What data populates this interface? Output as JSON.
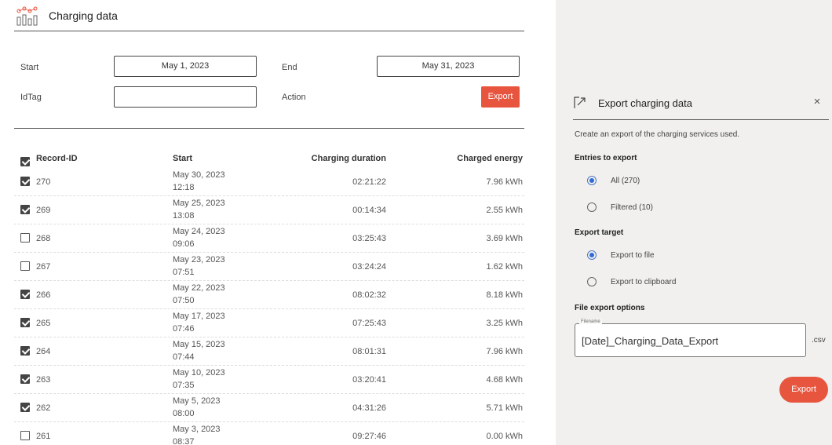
{
  "header": {
    "title": "Charging data"
  },
  "filters": {
    "start_label": "Start",
    "start_value": "May 1, 2023",
    "end_label": "End",
    "end_value": "May 31, 2023",
    "idtag_label": "IdTag",
    "idtag_value": "",
    "action_label": "Action",
    "export_label": "Export"
  },
  "table": {
    "headers": {
      "record_id": "Record-ID",
      "start": "Start",
      "duration": "Charging duration",
      "energy": "Charged energy"
    },
    "rows": [
      {
        "checked": true,
        "id": "270",
        "date": "May 30, 2023",
        "time": "12:18",
        "duration": "02:21:22",
        "energy": "7.96 kWh"
      },
      {
        "checked": true,
        "id": "269",
        "date": "May 25, 2023",
        "time": "13:08",
        "duration": "00:14:34",
        "energy": "2.55 kWh"
      },
      {
        "checked": false,
        "id": "268",
        "date": "May 24, 2023",
        "time": "09:06",
        "duration": "03:25:43",
        "energy": "3.69 kWh"
      },
      {
        "checked": false,
        "id": "267",
        "date": "May 23, 2023",
        "time": "07:51",
        "duration": "03:24:24",
        "energy": "1.62 kWh"
      },
      {
        "checked": true,
        "id": "266",
        "date": "May 22, 2023",
        "time": "07:50",
        "duration": "08:02:32",
        "energy": "8.18 kWh"
      },
      {
        "checked": true,
        "id": "265",
        "date": "May 17, 2023",
        "time": "07:46",
        "duration": "07:25:43",
        "energy": "3.25 kWh"
      },
      {
        "checked": true,
        "id": "264",
        "date": "May 15, 2023",
        "time": "07:44",
        "duration": "08:01:31",
        "energy": "7.96 kWh"
      },
      {
        "checked": true,
        "id": "263",
        "date": "May 10, 2023",
        "time": "07:35",
        "duration": "03:20:41",
        "energy": "4.68 kWh"
      },
      {
        "checked": true,
        "id": "262",
        "date": "May 5, 2023",
        "time": "08:00",
        "duration": "04:31:26",
        "energy": "5.71 kWh"
      },
      {
        "checked": false,
        "id": "261",
        "date": "May 3, 2023",
        "time": "08:37",
        "duration": "09:27:46",
        "energy": "0.00 kWh"
      }
    ]
  },
  "panel": {
    "title": "Export charging data",
    "close": "×",
    "description": "Create an export of the charging services used.",
    "entries_heading": "Entries to export",
    "entries_all": "All (270)",
    "entries_filtered": "Filtered (10)",
    "target_heading": "Export target",
    "target_file": "Export to file",
    "target_clipboard": "Export to clipboard",
    "options_heading": "File export options",
    "filename_legend": "Filename",
    "filename_value": "[Date]_Charging_Data_Export",
    "extension": ".csv",
    "export_label": "Export"
  },
  "colors": {
    "accent": "#e8553f",
    "radio": "#2f6bd8",
    "panel_bg": "#f1f0ee"
  },
  "icons": {
    "logo": "chart-logo-icon",
    "export": "export-arrow-icon",
    "close": "close-icon"
  }
}
